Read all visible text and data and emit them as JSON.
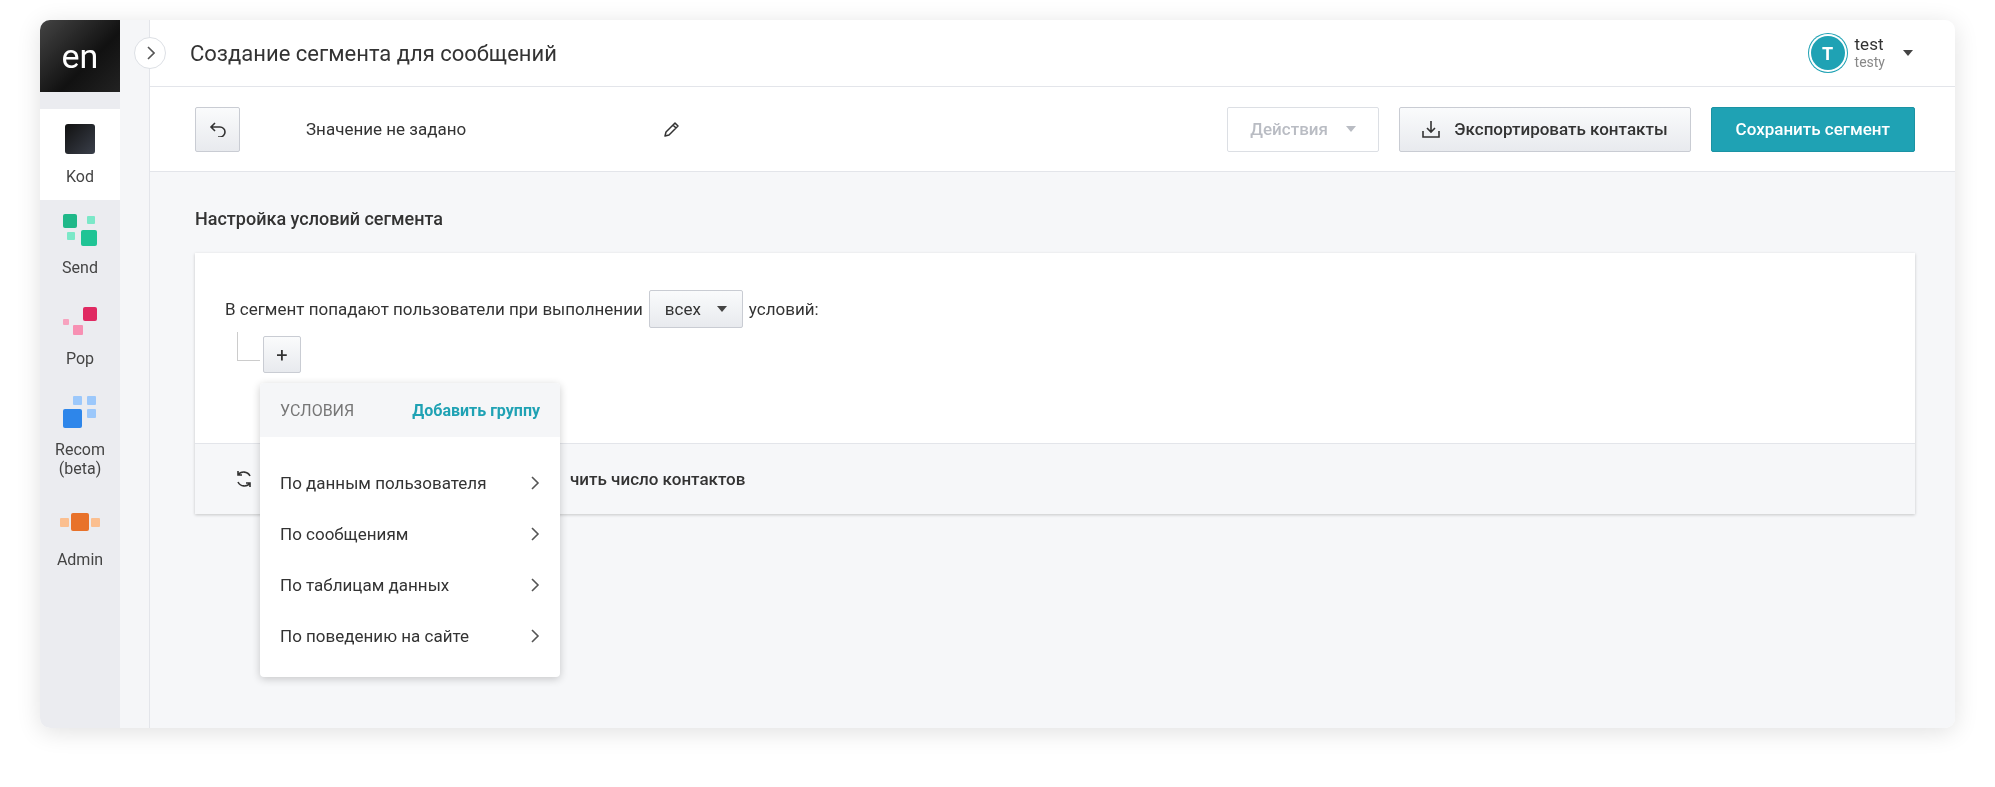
{
  "logo": "en",
  "sidebar": {
    "items": [
      {
        "label": "Kod",
        "selected": true
      },
      {
        "label": "Send",
        "selected": false
      },
      {
        "label": "Pop",
        "selected": false
      },
      {
        "label": "Recom (beta)",
        "selected": false
      },
      {
        "label": "Admin",
        "selected": false
      }
    ]
  },
  "header": {
    "title": "Создание сегмента для сообщений",
    "user": {
      "avatar": "T",
      "name": "test",
      "login": "testy"
    }
  },
  "toolbar": {
    "name": "Значение не задано",
    "actions": {
      "label": "Действия",
      "disabled": true
    },
    "export": "Экспортировать контакты",
    "save": "Сохранить сегмент"
  },
  "section_title": "Настройка условий сегмента",
  "card": {
    "rule_prefix": "В сегмент попадают пользователи при выполнении",
    "match": "всех",
    "rule_suffix": "условий:",
    "add": "+",
    "footer": "чить число контактов"
  },
  "menu": {
    "title": "УСЛОВИЯ",
    "add_group": "Добавить группу",
    "items": [
      {
        "label": "По данным пользователя"
      },
      {
        "label": "По сообщениям"
      },
      {
        "label": "По таблицам данных"
      },
      {
        "label": "По поведению на сайте"
      }
    ]
  }
}
